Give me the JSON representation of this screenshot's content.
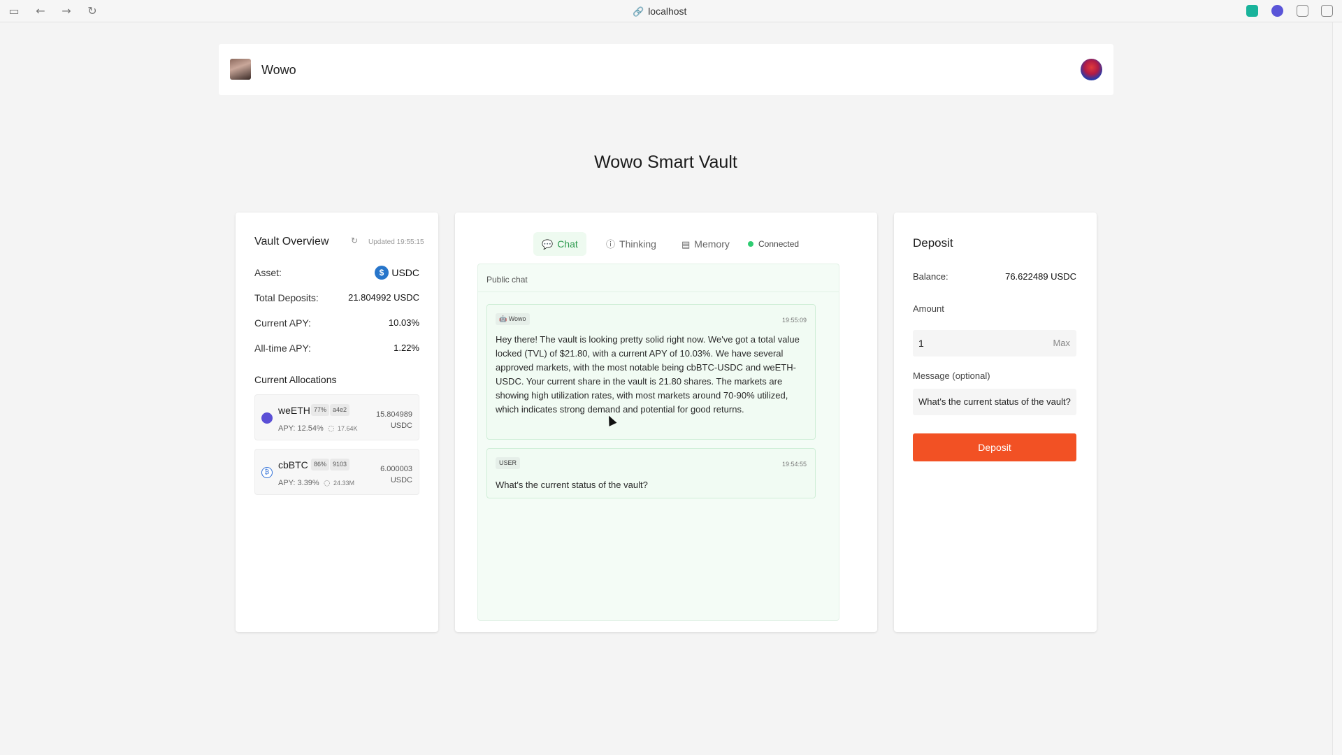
{
  "browser": {
    "url": "localhost",
    "icons": [
      "sidebar-icon",
      "back-icon",
      "forward-icon",
      "reload-icon",
      "link-icon"
    ]
  },
  "header": {
    "app_name": "Wowo"
  },
  "page_title": "Wowo Smart Vault",
  "overview": {
    "title": "Vault Overview",
    "updated": "Updated 19:55:15",
    "rows": [
      {
        "label": "Asset:",
        "value": "USDC"
      },
      {
        "label": "Total Deposits:",
        "value": "21.804992 USDC"
      },
      {
        "label": "Current APY:",
        "value": "10.03%"
      },
      {
        "label": "All-time APY:",
        "value": "1.22%"
      }
    ],
    "allocations_title": "Current Allocations",
    "allocations": [
      {
        "symbol": "weETH",
        "util": "77%",
        "id": "a4e2",
        "apy": "APY: 12.54%",
        "tvl": "17.64K",
        "amount": "15.804989",
        "unit": "USDC",
        "color": "#5b4fd6"
      },
      {
        "symbol": "cbBTC",
        "util": "86%",
        "id": "9103",
        "apy": "APY: 3.39%",
        "tvl": "24.33M",
        "amount": "6.000003",
        "unit": "USDC",
        "color": "#2f6fd6"
      }
    ]
  },
  "chat": {
    "tabs": [
      {
        "label": "Chat",
        "icon": "chat-bubble-icon",
        "active": true
      },
      {
        "label": "Thinking",
        "icon": "lightbulb-icon",
        "active": false
      },
      {
        "label": "Memory",
        "icon": "memory-icon",
        "active": false
      }
    ],
    "status": "Connected",
    "panel_title": "Public chat",
    "messages": [
      {
        "author": "Wowo",
        "time": "19:55:09",
        "text": "Hey there! The vault is looking pretty solid right now. We've got a total value locked (TVL) of $21.80, with a current APY of 10.03%. We have several approved markets, with the most notable being cbBTC-USDC and weETH-USDC. Your current share in the vault is 21.80 shares. The markets are showing high utilization rates, with most markets around 70-90% utilized, which indicates strong demand and potential for good returns."
      },
      {
        "author": "USER",
        "time": "19:54:55",
        "text": "What's the current status of the vault?"
      }
    ]
  },
  "deposit": {
    "title": "Deposit",
    "balance_label": "Balance:",
    "balance_value": "76.622489 USDC",
    "amount_label": "Amount",
    "amount_value": "1",
    "max_label": "Max",
    "message_label": "Message (optional)",
    "message_value": "What's the current status of the vault?",
    "button_label": "Deposit"
  },
  "colors": {
    "accent": "#f25124",
    "chat_green": "#2e9b4f",
    "connected": "#2ecc71"
  }
}
